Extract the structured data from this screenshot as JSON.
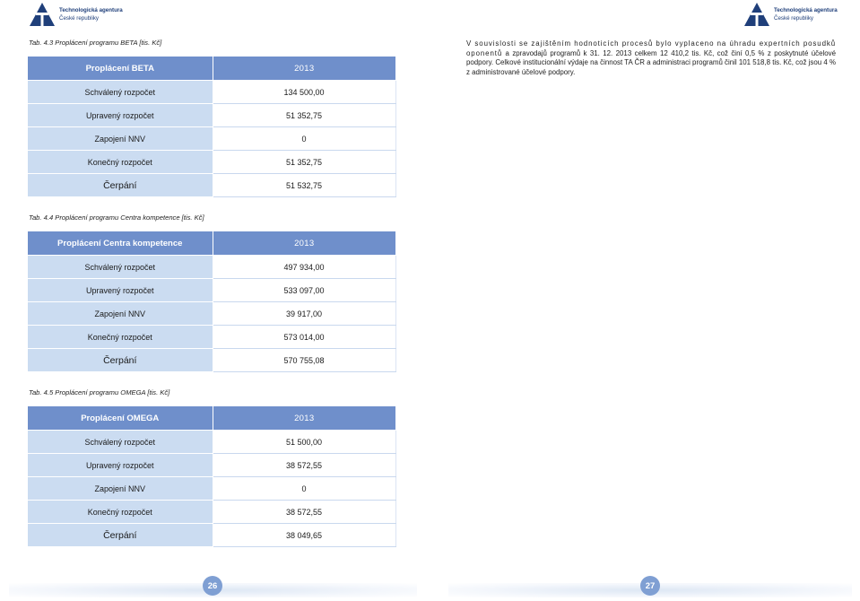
{
  "logo": {
    "line1": "Technologická agentura",
    "line2": "České republiky"
  },
  "tables": [
    {
      "caption": "Tab. 4.3 Proplácení programu BETA [tis. Kč]",
      "header": "Proplácení BETA",
      "year": "2013",
      "rows": [
        {
          "label": "Schválený rozpočet",
          "value": "134 500,00"
        },
        {
          "label": "Upravený rozpočet",
          "value": "51 352,75"
        },
        {
          "label": "Zapojení NNV",
          "value": "0"
        },
        {
          "label": "Konečný rozpočet",
          "value": "51 352,75"
        },
        {
          "label": "Čerpání",
          "value": "51 532,75"
        }
      ]
    },
    {
      "caption": "Tab. 4.4 Proplácení programu Centra kompetence [tis. Kč]",
      "header": "Proplácení Centra kompetence",
      "year": "2013",
      "rows": [
        {
          "label": "Schválený rozpočet",
          "value": "497 934,00"
        },
        {
          "label": "Upravený rozpočet",
          "value": "533 097,00"
        },
        {
          "label": "Zapojení NNV",
          "value": "39 917,00"
        },
        {
          "label": "Konečný rozpočet",
          "value": "573 014,00"
        },
        {
          "label": "Čerpání",
          "value": "570 755,08"
        }
      ]
    },
    {
      "caption": "Tab. 4.5 Proplácení programu OMEGA [tis. Kč]",
      "header": "Proplácení OMEGA",
      "year": "2013",
      "rows": [
        {
          "label": "Schválený rozpočet",
          "value": "51 500,00"
        },
        {
          "label": "Upravený rozpočet",
          "value": "38 572,55"
        },
        {
          "label": "Zapojení NNV",
          "value": "0"
        },
        {
          "label": "Konečný rozpočet",
          "value": "38 572,55"
        },
        {
          "label": "Čerpání",
          "value": "38 049,65"
        }
      ]
    }
  ],
  "paragraph": {
    "line1": "V souvislosti se zajištěním hodnoticích procesů bylo vyplaceno na úhradu expertních posudků oponentů",
    "rest": "a zpravodajů programů k 31. 12. 2013 celkem 12 410,2 tis. Kč, což činí 0,5 % z poskytnuté účelové podpory. Celkové institucionální výdaje na činnost TA ČR a administraci programů činil 101 518,8 tis. Kč, což jsou 4 % z administrované účelové podpory."
  },
  "pages": {
    "left": "26",
    "right": "27"
  },
  "colors": {
    "header": "#6f8fcb",
    "label_cell": "#cbdcf1",
    "page_badge": "#7f9fd3",
    "logo": "#1f3f7a"
  }
}
